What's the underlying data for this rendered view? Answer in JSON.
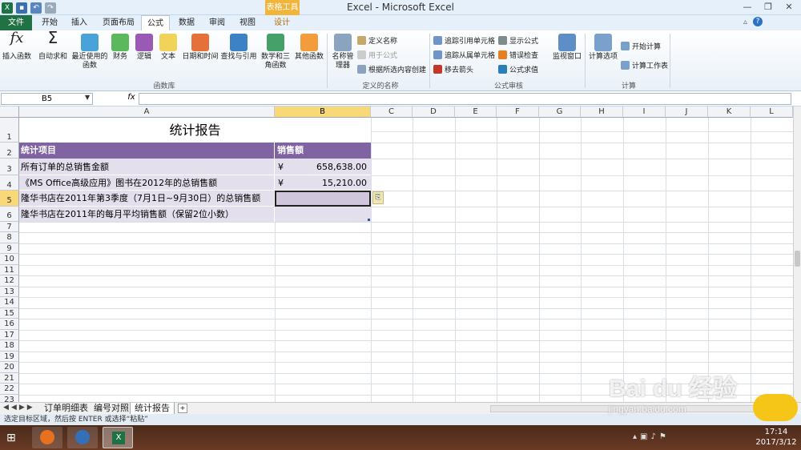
{
  "app": {
    "title": "Excel - Microsoft Excel",
    "context_tab": "表格工具"
  },
  "tabs": [
    "文件",
    "开始",
    "插入",
    "页面布局",
    "公式",
    "数据",
    "审阅",
    "视图",
    "设计"
  ],
  "active_tab": "公式",
  "ribbon": {
    "function_library": {
      "label": "函数库",
      "buttons": [
        "插入函数",
        "自动求和",
        "最近使用的函数",
        "财务",
        "逻辑",
        "文本",
        "日期和时间",
        "查找与引用",
        "数学和三角函数",
        "其他函数"
      ]
    },
    "defined_names": {
      "label": "定义的名称",
      "big": "名称管理器",
      "small": [
        "定义名称",
        "用于公式",
        "根据所选内容创建"
      ]
    },
    "formula_auditing": {
      "label": "公式审核",
      "small": [
        "追踪引用单元格",
        "追踪从属单元格",
        "移去箭头",
        "显示公式",
        "错误检查",
        "公式求值"
      ],
      "big": "监视窗口"
    },
    "calculation": {
      "label": "计算",
      "big": "计算选项",
      "small": [
        "开始计算",
        "计算工作表"
      ]
    }
  },
  "formula_bar": {
    "name_box": "B5",
    "fx": "fx",
    "value": ""
  },
  "columns": [
    "A",
    "B",
    "C",
    "D",
    "E",
    "F",
    "G",
    "H",
    "I",
    "J",
    "K",
    "L"
  ],
  "rows": [
    "1",
    "2",
    "3",
    "4",
    "5",
    "6",
    "7",
    "8",
    "9",
    "10",
    "11",
    "12",
    "13",
    "14",
    "15",
    "16",
    "17",
    "18",
    "19",
    "20",
    "21",
    "22",
    "23"
  ],
  "sheet": {
    "title": "统计报告",
    "header": {
      "item": "统计项目",
      "amount": "销售额"
    },
    "rows": [
      {
        "label": "所有订单的总销售金额",
        "currency": "¥",
        "value": "658,638.00"
      },
      {
        "label": "《MS Office高级应用》图书在2012年的总销售额",
        "currency": "¥",
        "value": "15,210.00"
      },
      {
        "label": "隆华书店在2011年第3季度（7月1日~9月30日）的总销售额",
        "currency": "",
        "value": ""
      },
      {
        "label": "隆华书店在2011年的每月平均销售额（保留2位小数）",
        "currency": "",
        "value": ""
      }
    ]
  },
  "sheet_tabs": [
    "订单明细表",
    "编号对照",
    "统计报告"
  ],
  "active_sheet": "统计报告",
  "status_text": "选定目标区域，然后按 ENTER 或选择“粘贴”",
  "taskbar": {
    "time": "17:14",
    "date": "2017/3/12"
  },
  "watermark": "Bai du 经验",
  "watermark_url": "jingyan.baidu.com",
  "colors": {
    "header_purple": "#8064a2",
    "row_purple": "#e4dfec",
    "selection_yellow": "#f8d877",
    "file_tab_green": "#207244"
  }
}
